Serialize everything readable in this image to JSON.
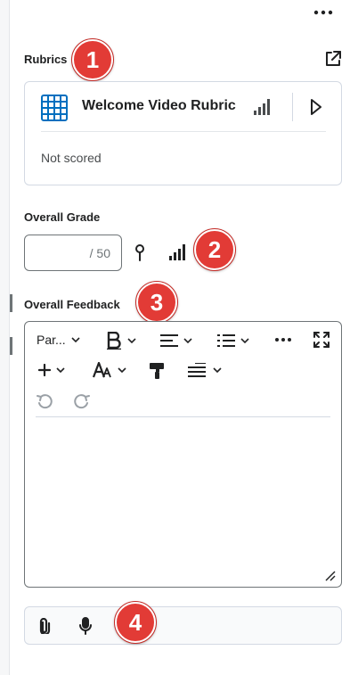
{
  "header": {
    "more_label": "More actions"
  },
  "rubrics": {
    "section_label": "Rubrics",
    "rubric_name": "Welcome Video Rubric",
    "status": "Not scored"
  },
  "overall_grade": {
    "section_label": "Overall Grade",
    "value": "",
    "denominator": "/ 50"
  },
  "overall_feedback": {
    "section_label": "Overall Feedback",
    "toolbar": {
      "paragraph_label": "Par..."
    }
  },
  "callouts": [
    "1",
    "2",
    "3",
    "4"
  ],
  "colors": {
    "accent_blue": "#006fbf",
    "callout_red": "#e23b36",
    "text_dark": "#202122",
    "border": "#d3d9e3"
  },
  "icons": {
    "more": "more-horizontal-icon",
    "external": "external-link-icon",
    "rubric": "rubric-grid-icon",
    "level": "signal-bars-icon",
    "play": "play-triangle-icon",
    "pin": "pin-icon",
    "bold": "bold-icon",
    "align": "align-icon",
    "list": "bulleted-list-icon",
    "fullscreen": "fullscreen-icon",
    "insert": "plus-icon",
    "font": "font-size-icon",
    "format_painter": "format-painter-icon",
    "line_spacing": "line-spacing-icon",
    "undo": "undo-icon",
    "redo": "redo-icon",
    "attach": "paperclip-icon",
    "record": "microphone-icon"
  }
}
